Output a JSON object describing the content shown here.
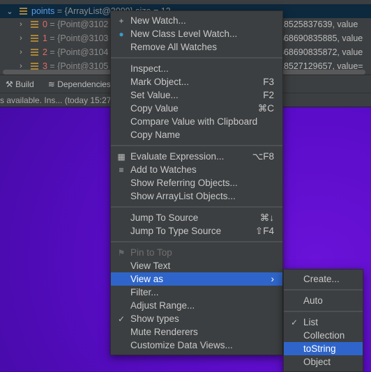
{
  "variables": {
    "parent_row": {
      "name": "points",
      "value": "{ArrayList@3099}  size = 12"
    },
    "children": [
      {
        "index": "0",
        "ref": "{Point@3102",
        "tail": "18525837639, value"
      },
      {
        "index": "1",
        "ref": "{Point@3103",
        "tail": "368690835885, value"
      },
      {
        "index": "2",
        "ref": "{Point@3104",
        "tail": "368690835872, value"
      },
      {
        "index": "3",
        "ref": "{Point@3105",
        "tail": "18527129657, value="
      }
    ]
  },
  "toolbar": {
    "build": "Build",
    "dependencies": "Dependencies"
  },
  "status": {
    "text": "s available. Ins... (today 15:27)"
  },
  "context_menu": {
    "new_watch": "New Watch...",
    "new_class_watch": "New Class Level Watch...",
    "remove_all": "Remove All Watches",
    "inspect": "Inspect...",
    "mark_object": "Mark Object...",
    "mark_object_sc": "F3",
    "set_value": "Set Value...",
    "set_value_sc": "F2",
    "copy_value": "Copy Value",
    "copy_value_sc": "⌘C",
    "compare": "Compare Value with Clipboard",
    "copy_name": "Copy Name",
    "evaluate": "Evaluate Expression...",
    "evaluate_sc": "⌥F8",
    "add_watches": "Add to Watches",
    "show_referring": "Show Referring Objects...",
    "show_arraylist": "Show ArrayList Objects...",
    "jump_source": "Jump To Source",
    "jump_source_sc": "⌘↓",
    "jump_type": "Jump To Type Source",
    "jump_type_sc": "⇧F4",
    "pin": "Pin to Top",
    "view_text": "View Text",
    "view_as": "View as",
    "filter": "Filter...",
    "adjust_range": "Adjust Range...",
    "show_types": "Show types",
    "show_types_checked": true,
    "mute": "Mute Renderers",
    "customize": "Customize Data Views..."
  },
  "submenu": {
    "create": "Create...",
    "auto": "Auto",
    "list": "List",
    "list_checked": true,
    "collection": "Collection",
    "tostring": "toString",
    "object": "Object",
    "highlighted": "toString"
  },
  "colors": {
    "highlight": "#2f65ca",
    "menu_bg": "#3c3f41",
    "selected_row": "#0d293e"
  }
}
